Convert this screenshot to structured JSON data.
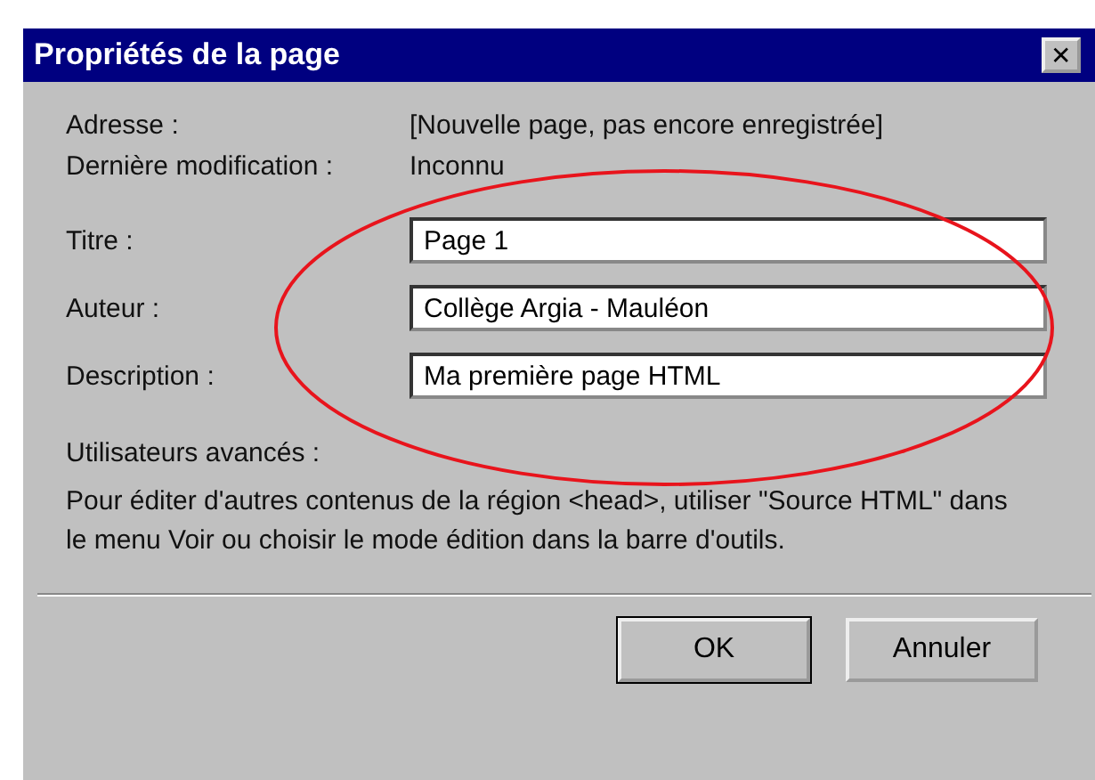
{
  "window": {
    "title": "Propriétés de la page",
    "close": "✕"
  },
  "info": [
    {
      "label": "Adresse :",
      "value": "[Nouvelle page, pas encore enregistrée]"
    },
    {
      "label": "Dernière modification :",
      "value": "Inconnu"
    }
  ],
  "fields": [
    {
      "label": "Titre :",
      "value": "Page 1"
    },
    {
      "label": "Auteur :",
      "value": "Collège Argia - Mauléon"
    },
    {
      "label": "Description :",
      "value": "Ma première page HTML"
    }
  ],
  "advanced": {
    "heading": "Utilisateurs avancés :",
    "text": "Pour éditer d'autres contenus de la région <head>, utiliser \"Source HTML\" dans le menu Voir ou choisir le mode édition dans la barre d'outils."
  },
  "buttons": [
    {
      "label": "OK",
      "default": true
    },
    {
      "label": "Annuler",
      "default": false
    }
  ]
}
